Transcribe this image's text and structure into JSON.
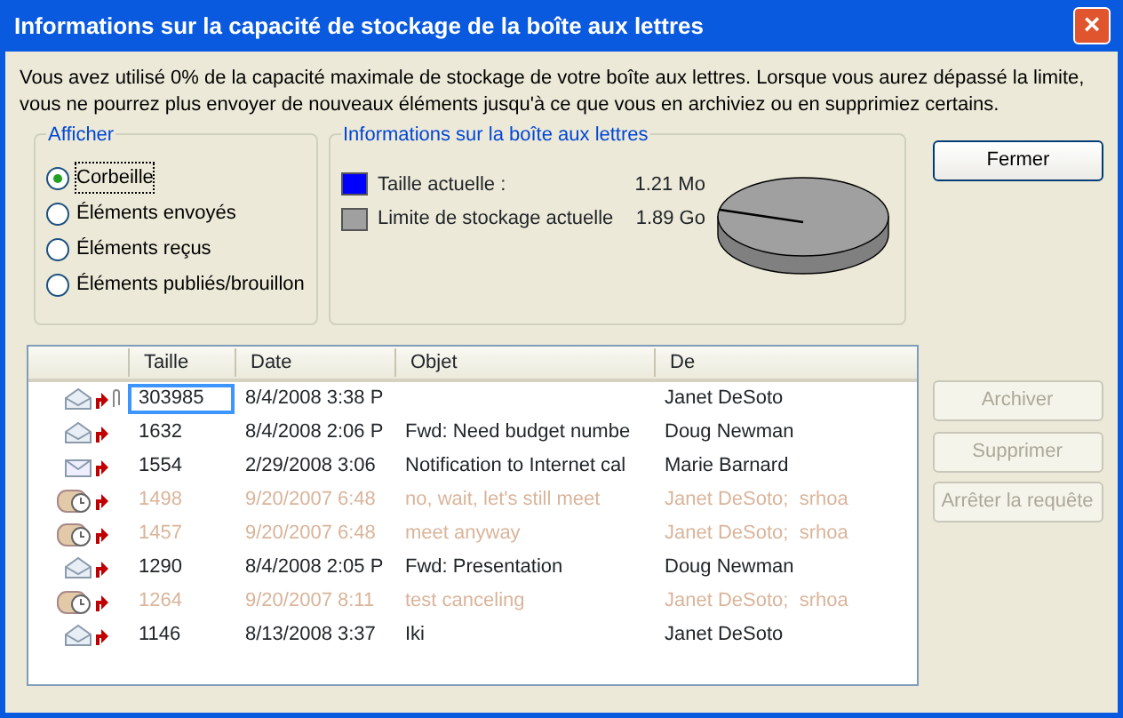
{
  "window": {
    "title": "Informations sur la capacité de stockage de la boîte aux lettres",
    "close": "×"
  },
  "message": "Vous avez utilisé 0% de la capacité maximale de stockage de votre boîte aux lettres. Lorsque vous aurez dépassé la limite, vous ne pourrez plus envoyer de nouveaux éléments jusqu'à ce que vous en archiviez ou en supprimiez certains.",
  "view_group": {
    "title": "Afficher",
    "options": [
      {
        "label": "Corbeille",
        "selected": true
      },
      {
        "label": "Éléments envoyés",
        "selected": false
      },
      {
        "label": "Éléments reçus",
        "selected": false
      },
      {
        "label": "Éléments publiés/brouillon",
        "selected": false
      }
    ]
  },
  "info_group": {
    "title": "Informations sur la boîte aux lettres",
    "legend": [
      {
        "label": "Taille actuelle :",
        "value": "1.21 Mo",
        "color": "#0000ff"
      },
      {
        "label": "Limite de stockage actuelle",
        "value": "1.89 Go",
        "color": "#a0a0a0"
      }
    ]
  },
  "table": {
    "columns": [
      "Taille",
      "Date",
      "Objet",
      "De"
    ],
    "rows": [
      {
        "kind": "open",
        "attachment": true,
        "dim": false,
        "selected": true,
        "cells": [
          "303985",
          "8/4/2008 3:38 P",
          "",
          "Janet DeSoto"
        ]
      },
      {
        "kind": "open",
        "attachment": false,
        "dim": false,
        "selected": false,
        "cells": [
          "1632",
          "8/4/2008 2:06 P",
          "Fwd: Need budget numbe",
          "Doug Newman"
        ]
      },
      {
        "kind": "closed",
        "attachment": false,
        "dim": false,
        "selected": false,
        "cells": [
          "1554",
          "2/29/2008 3:06",
          "Notification to Internet cal",
          "Marie Barnard"
        ]
      },
      {
        "kind": "meeting",
        "attachment": false,
        "dim": true,
        "selected": false,
        "cells": [
          "1498",
          "9/20/2007 6:48",
          "no, wait, let's still meet",
          "Janet DeSoto;  srhoa"
        ]
      },
      {
        "kind": "meeting",
        "attachment": false,
        "dim": true,
        "selected": false,
        "cells": [
          "1457",
          "9/20/2007 6:48",
          "meet anyway",
          "Janet DeSoto;  srhoa"
        ]
      },
      {
        "kind": "open",
        "attachment": false,
        "dim": false,
        "selected": false,
        "cells": [
          "1290",
          "8/4/2008 2:05 P",
          "Fwd: Presentation",
          "Doug Newman"
        ]
      },
      {
        "kind": "meeting",
        "attachment": false,
        "dim": true,
        "selected": false,
        "cells": [
          "1264",
          "9/20/2007 8:11",
          "test canceling",
          "Janet DeSoto;  srhoa"
        ]
      },
      {
        "kind": "open",
        "attachment": false,
        "dim": false,
        "selected": false,
        "cells": [
          "1146",
          "8/13/2008 3:37",
          "Iki",
          "Janet DeSoto"
        ]
      }
    ]
  },
  "buttons": [
    {
      "label": "Fermer",
      "disabled": false
    },
    {
      "label": "Archiver",
      "disabled": true
    },
    {
      "label": "Supprimer",
      "disabled": true
    },
    {
      "label": "Arrêter la requête",
      "disabled": true
    }
  ]
}
